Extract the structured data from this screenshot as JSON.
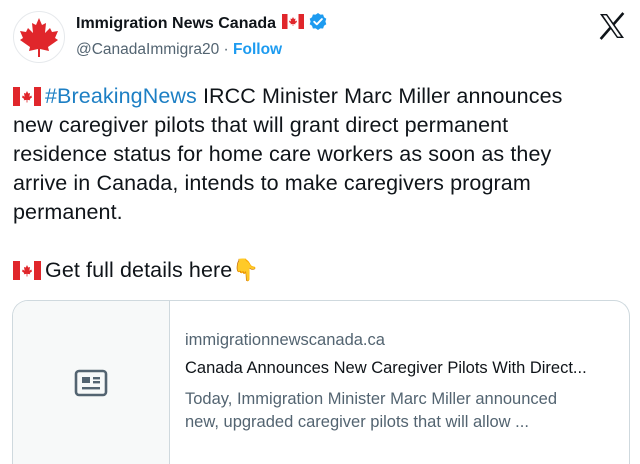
{
  "account": {
    "display_name": "Immigration News Canada",
    "handle": "@CanadaImmigra20",
    "separator": " · ",
    "follow_label": "Follow"
  },
  "tweet": {
    "hashtag": "#BreakingNews",
    "line1_rest": " IRCC Minister Marc Miller announces",
    "line2": "new caregiver pilots that will grant direct permanent",
    "line3": "residence status for home care workers as soon as they",
    "line4": "arrive in Canada, intends to make caregivers program",
    "line5": "permanent.",
    "cta": "Get full details here",
    "cta_emoji": "👇"
  },
  "card": {
    "domain": "immigrationnewscanada.ca",
    "title": "Canada Announces New Caregiver Pilots With Direct...",
    "desc_line1": "Today, Immigration Minister Marc Miller announced",
    "desc_line2": "new, upgraded caregiver pilots that will allow ..."
  },
  "colors": {
    "accent": "#1d9bf0",
    "hashtag": "#1d7fc4",
    "flag_red": "#e0262b"
  },
  "icons": [
    "avatar-maple-leaf",
    "canada-flag-icon",
    "verified-badge-icon",
    "x-logo-icon",
    "article-icon"
  ]
}
